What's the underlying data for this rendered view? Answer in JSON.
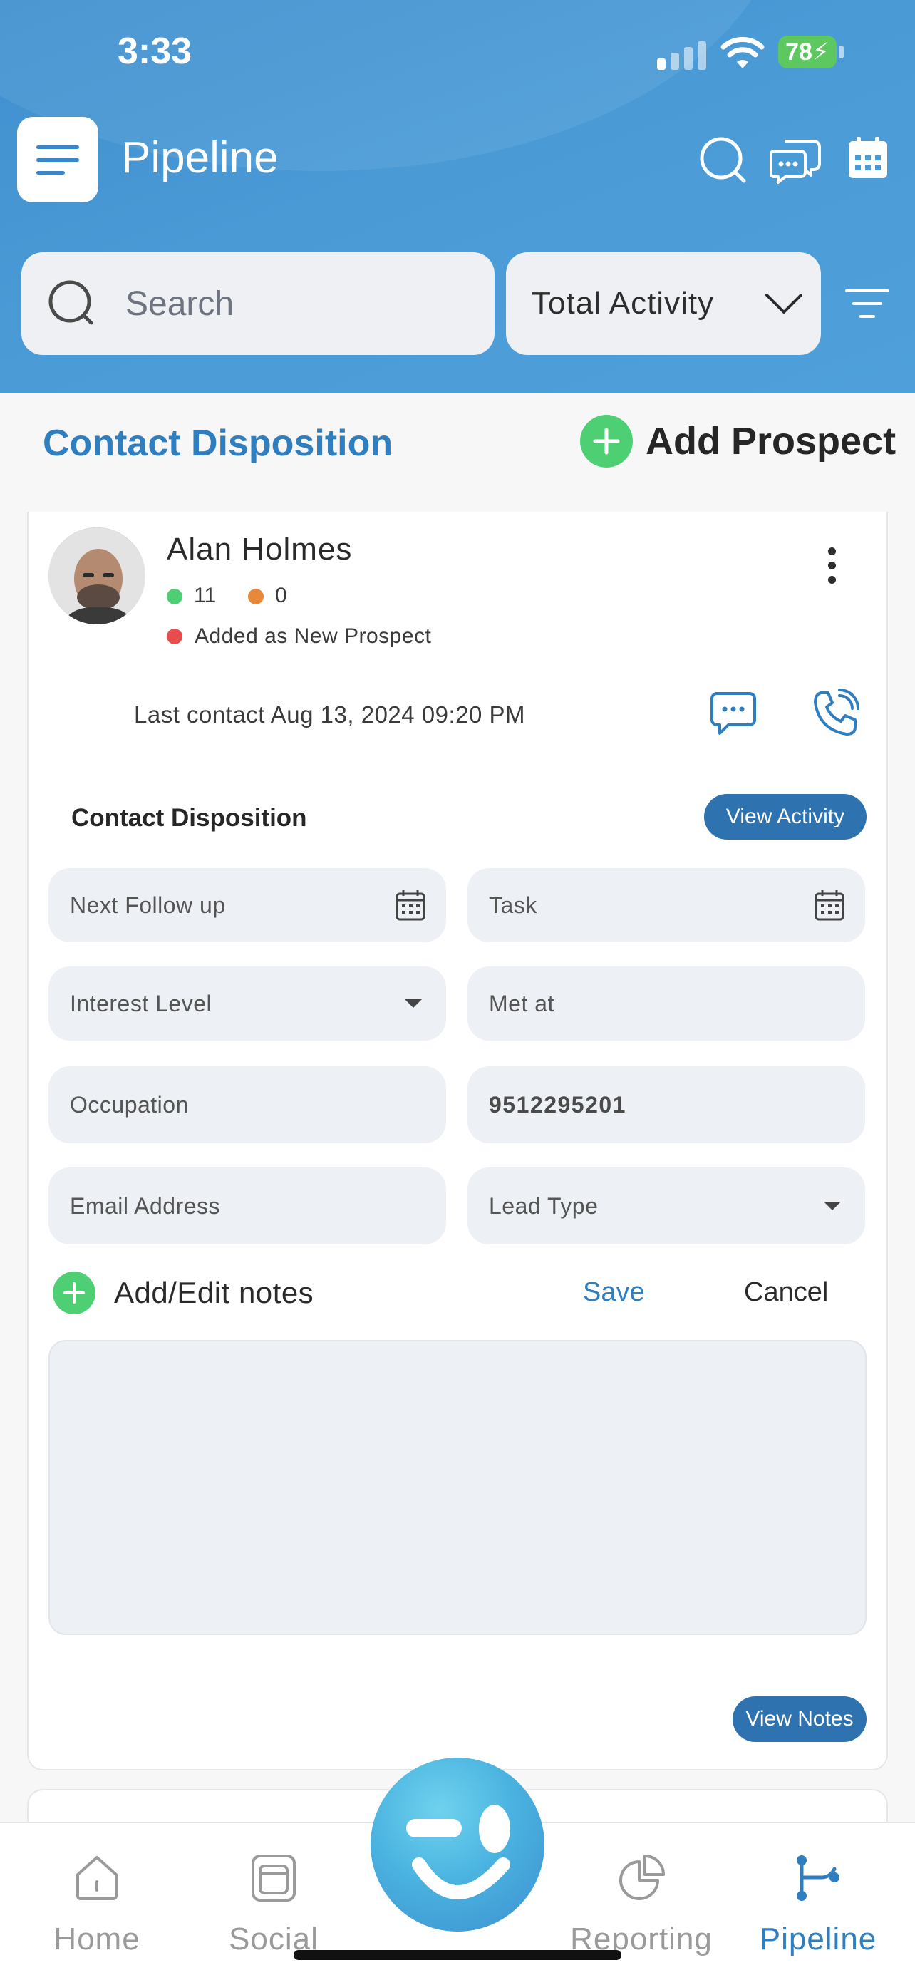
{
  "status_bar": {
    "time": "3:33",
    "battery": "78"
  },
  "header": {
    "title": "Pipeline",
    "icons": [
      "menu-icon",
      "search-icon",
      "chat-icon",
      "calendar-icon"
    ]
  },
  "search": {
    "placeholder": "Search"
  },
  "activity_filter": {
    "selected": "Total Activity"
  },
  "section": {
    "title": "Contact Disposition",
    "add_label": "Add Prospect"
  },
  "contact": {
    "name": "Alan Holmes",
    "green_count": "11",
    "orange_count": "0",
    "status": "Added as New Prospect",
    "last_contact": "Last contact Aug 13, 2024 09:20 PM"
  },
  "disposition": {
    "label": "Contact Disposition",
    "view_activity": "View Activity",
    "fields": {
      "next_follow_up": "Next Follow up",
      "task": "Task",
      "interest_level": "Interest Level",
      "met_at": "Met at",
      "occupation": "Occupation",
      "phone": "9512295201",
      "email": "Email Address",
      "lead_type": "Lead Type"
    }
  },
  "notes": {
    "add_label": "Add/Edit notes",
    "save": "Save",
    "cancel": "Cancel",
    "view_notes": "View Notes"
  },
  "tabs": [
    {
      "label": "Home",
      "icon": "home-icon"
    },
    {
      "label": "Social",
      "icon": "social-icon"
    },
    {
      "label": "Reporting",
      "icon": "reporting-icon"
    },
    {
      "label": "Pipeline",
      "icon": "pipeline-icon",
      "active": true
    }
  ],
  "colors": {
    "accent": "#2f7fc0",
    "header": "#4a9ad6",
    "green": "#4fcf73",
    "orange": "#e8883a",
    "red": "#e84d4d"
  }
}
